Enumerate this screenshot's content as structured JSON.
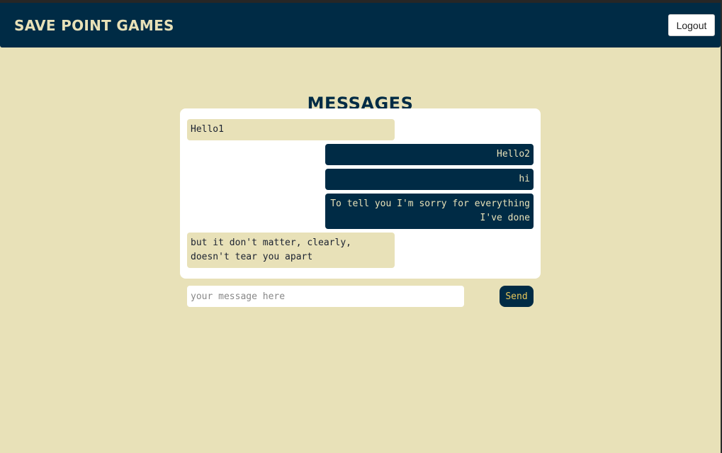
{
  "navbar": {
    "brand": "Save Point Games",
    "logout_label": "Logout"
  },
  "page": {
    "title": "Messages"
  },
  "messages": [
    {
      "side": "received",
      "text": "Hello1"
    },
    {
      "side": "sent",
      "text": "Hello2"
    },
    {
      "side": "sent",
      "text": "hi"
    },
    {
      "side": "sent",
      "text": "To tell you I'm sorry for everything I've done"
    },
    {
      "side": "received",
      "text": "but it don't matter, clearly, doesn't tear you apart"
    }
  ],
  "composer": {
    "value": "",
    "placeholder": "your message here",
    "send_label": "Send"
  },
  "colors": {
    "background": "#e8e1b8",
    "navy": "#002b45",
    "sent_text": "#e8e1b8",
    "send_text": "#e8c75a"
  }
}
